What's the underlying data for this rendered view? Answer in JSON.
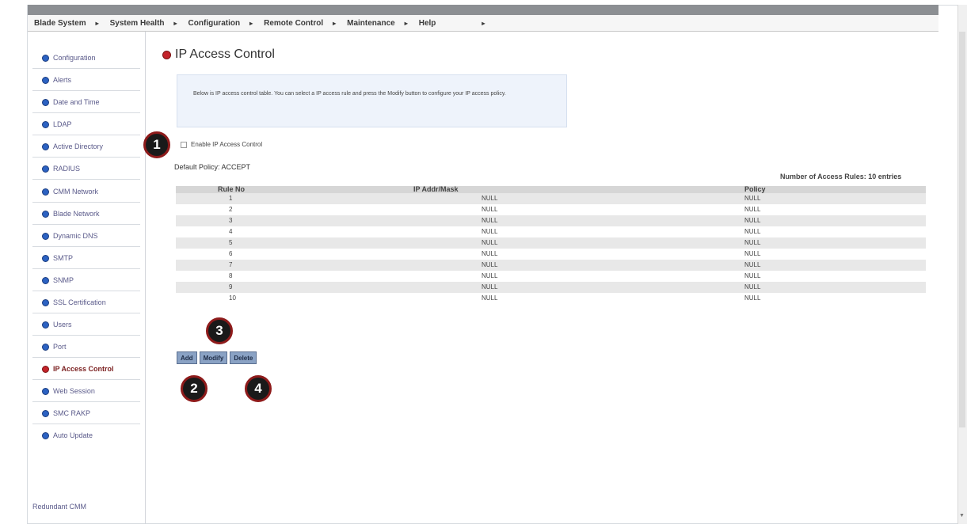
{
  "menu": [
    {
      "label": "Blade System"
    },
    {
      "label": "System Health"
    },
    {
      "label": "Configuration"
    },
    {
      "label": "Remote Control"
    },
    {
      "label": "Maintenance"
    },
    {
      "label": "Help"
    }
  ],
  "sidebar": {
    "items": [
      {
        "label": "Configuration"
      },
      {
        "label": "Alerts"
      },
      {
        "label": "Date and Time"
      },
      {
        "label": "LDAP"
      },
      {
        "label": "Active Directory"
      },
      {
        "label": "RADIUS"
      },
      {
        "label": "CMM Network"
      },
      {
        "label": "Blade Network"
      },
      {
        "label": "Dynamic DNS"
      },
      {
        "label": "SMTP"
      },
      {
        "label": "SNMP"
      },
      {
        "label": "SSL Certification"
      },
      {
        "label": "Users"
      },
      {
        "label": "Port"
      },
      {
        "label": "IP Access Control",
        "active": true
      },
      {
        "label": "Web Session"
      },
      {
        "label": "SMC RAKP"
      },
      {
        "label": "Auto Update"
      }
    ],
    "footer": "Redundant CMM"
  },
  "page": {
    "title": "IP Access Control",
    "info": "Below is IP access control table. You can select a IP access rule and press the Modify button to configure your IP access policy.",
    "enable_label": "Enable IP Access Control",
    "enable_checked": false,
    "default_policy": "Default Policy: ACCEPT",
    "rules_count": "Number of Access Rules: 10 entries"
  },
  "table": {
    "headers": [
      "Rule No",
      "IP Addr/Mask",
      "Policy"
    ],
    "rows": [
      {
        "rule": "1",
        "ip": "NULL",
        "policy": "NULL"
      },
      {
        "rule": "2",
        "ip": "NULL",
        "policy": "NULL"
      },
      {
        "rule": "3",
        "ip": "NULL",
        "policy": "NULL"
      },
      {
        "rule": "4",
        "ip": "NULL",
        "policy": "NULL"
      },
      {
        "rule": "5",
        "ip": "NULL",
        "policy": "NULL"
      },
      {
        "rule": "6",
        "ip": "NULL",
        "policy": "NULL"
      },
      {
        "rule": "7",
        "ip": "NULL",
        "policy": "NULL"
      },
      {
        "rule": "8",
        "ip": "NULL",
        "policy": "NULL"
      },
      {
        "rule": "9",
        "ip": "NULL",
        "policy": "NULL"
      },
      {
        "rule": "10",
        "ip": "NULL",
        "policy": "NULL"
      }
    ]
  },
  "buttons": {
    "add": "Add",
    "modify": "Modify",
    "delete": "Delete"
  },
  "markers": [
    "1",
    "2",
    "3",
    "4"
  ],
  "colors": {
    "active_bullet": "#c3232a",
    "bullet": "#2c62c2",
    "button": "#8aa2c4",
    "marker_ring": "#8e1b1b"
  }
}
